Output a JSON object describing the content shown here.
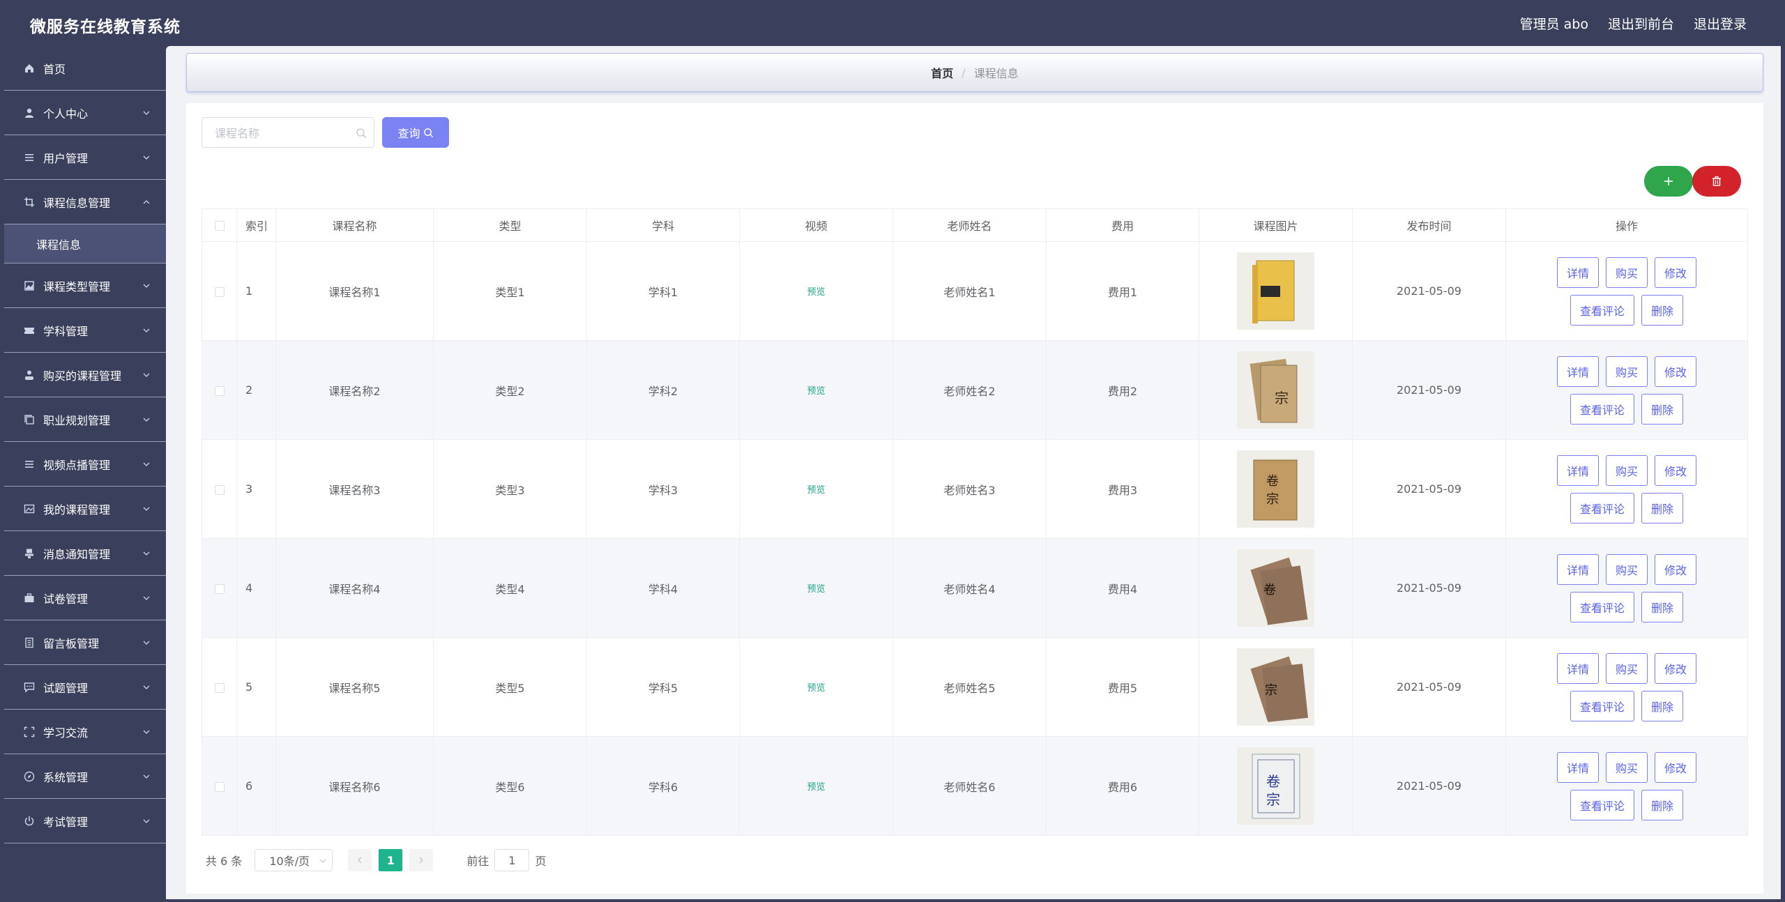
{
  "app": {
    "title": "微服务在线教育系统"
  },
  "top_links": {
    "user": "管理员 abo",
    "frontend": "退出到前台",
    "logout": "退出登录"
  },
  "sidebar": {
    "items": [
      {
        "label": "首页",
        "icon": "home-icon"
      },
      {
        "label": "个人中心",
        "icon": "user-icon"
      },
      {
        "label": "用户管理",
        "icon": "list-icon"
      },
      {
        "label": "课程信息管理",
        "icon": "crop-icon",
        "expanded": true
      },
      {
        "label": "课程类型管理",
        "icon": "image-icon"
      },
      {
        "label": "学科管理",
        "icon": "ticket-icon"
      },
      {
        "label": "购买的课程管理",
        "icon": "user-solid-icon"
      },
      {
        "label": "职业规划管理",
        "icon": "copy-icon"
      },
      {
        "label": "视频点播管理",
        "icon": "list-icon"
      },
      {
        "label": "我的课程管理",
        "icon": "picture-icon"
      },
      {
        "label": "消息通知管理",
        "icon": "stamp-icon"
      },
      {
        "label": "试卷管理",
        "icon": "briefcase-icon"
      },
      {
        "label": "留言板管理",
        "icon": "notebook-icon"
      },
      {
        "label": "试题管理",
        "icon": "chat-icon"
      },
      {
        "label": "学习交流",
        "icon": "fullscreen-icon"
      },
      {
        "label": "系统管理",
        "icon": "compass-icon"
      },
      {
        "label": "考试管理",
        "icon": "power-icon"
      }
    ],
    "submenu": "课程信息"
  },
  "breadcrumb": {
    "home": "首页",
    "sep": "/",
    "current": "课程信息"
  },
  "search": {
    "placeholder": "课程名称",
    "button": "查询"
  },
  "table": {
    "headers": [
      "索引",
      "课程名称",
      "类型",
      "学科",
      "视频",
      "老师姓名",
      "费用",
      "课程图片",
      "发布时间",
      "操作"
    ],
    "rows": [
      {
        "idx": "1",
        "name": "课程名称1",
        "type": "类型1",
        "subject": "学科1",
        "video": "预览",
        "teacher": "老师姓名1",
        "fee": "费用1",
        "date": "2021-05-09"
      },
      {
        "idx": "2",
        "name": "课程名称2",
        "type": "类型2",
        "subject": "学科2",
        "video": "预览",
        "teacher": "老师姓名2",
        "fee": "费用2",
        "date": "2021-05-09"
      },
      {
        "idx": "3",
        "name": "课程名称3",
        "type": "类型3",
        "subject": "学科3",
        "video": "预览",
        "teacher": "老师姓名3",
        "fee": "费用3",
        "date": "2021-05-09"
      },
      {
        "idx": "4",
        "name": "课程名称4",
        "type": "类型4",
        "subject": "学科4",
        "video": "预览",
        "teacher": "老师姓名4",
        "fee": "费用4",
        "date": "2021-05-09"
      },
      {
        "idx": "5",
        "name": "课程名称5",
        "type": "类型5",
        "subject": "学科5",
        "video": "预览",
        "teacher": "老师姓名5",
        "fee": "费用5",
        "date": "2021-05-09"
      },
      {
        "idx": "6",
        "name": "课程名称6",
        "type": "类型6",
        "subject": "学科6",
        "video": "预览",
        "teacher": "老师姓名6",
        "fee": "费用6",
        "date": "2021-05-09"
      }
    ],
    "actions": {
      "detail": "详情",
      "buy": "购买",
      "edit": "修改",
      "comments": "查看评论",
      "delete": "删除"
    }
  },
  "pager": {
    "total": "共 6 条",
    "page_size": "10条/页",
    "current": "1",
    "goto_label": "前往",
    "goto_value": "1",
    "page_suffix": "页"
  },
  "colors": {
    "sidebar": "#3a3f5c",
    "accent": "#7b83f3",
    "add": "#2fa64b",
    "delete": "#d2232a",
    "pager": "#1fb38e"
  }
}
